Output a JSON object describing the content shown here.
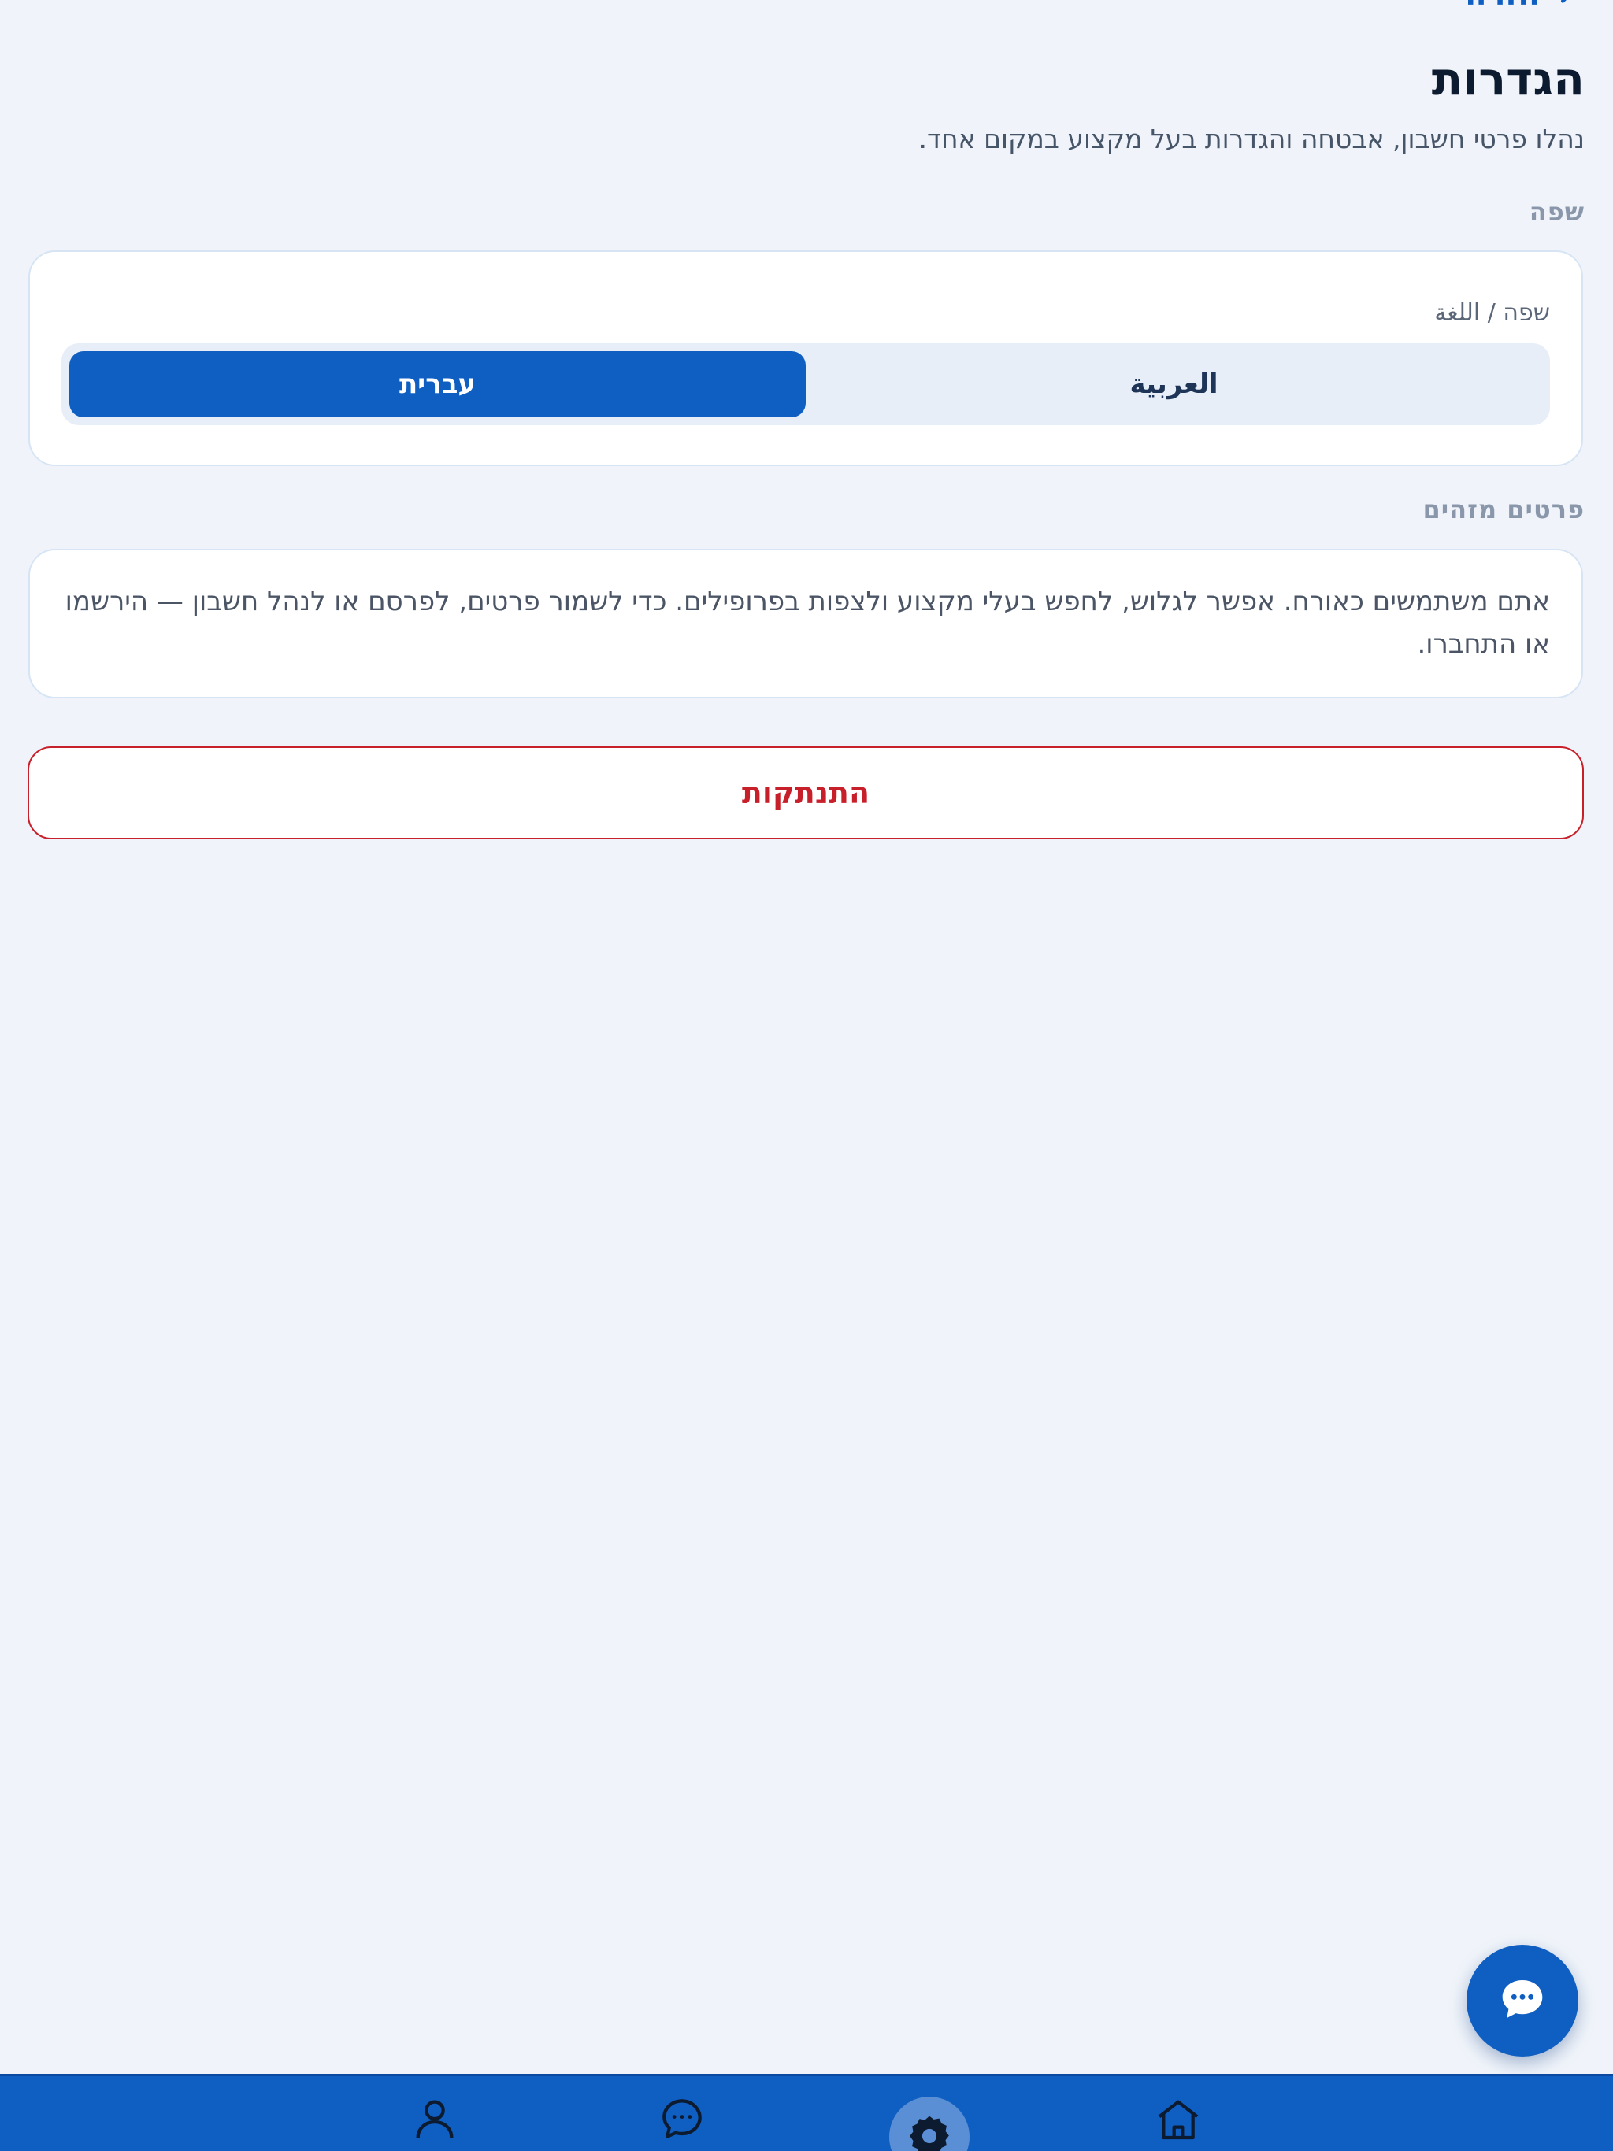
{
  "header": {
    "back_label": "חזרה",
    "title": "הגדרות",
    "subtitle": "נהלו פרטי חשבון, אבטחה והגדרות בעל מקצוע במקום אחד."
  },
  "language_section": {
    "heading": "שפה",
    "field_label": "שפה / اللغة",
    "options": [
      {
        "label": "עברית",
        "selected": true
      },
      {
        "label": "العربية",
        "selected": false
      }
    ]
  },
  "identity_section": {
    "heading": "פרטים מזהים",
    "text": "אתם משתמשים כאורח. אפשר לגלוש, לחפש בעלי מקצוע ולצפות בפרופילים. כדי לשמור פרטים, לפרסם או לנהל חשבון — הירשמו או התחברו."
  },
  "logout_label": "התנתקות",
  "chat_fab": {
    "icon": "chat-bubble-icon"
  },
  "bottom_nav": {
    "items": [
      {
        "icon": "home-icon",
        "active": false
      },
      {
        "icon": "gear-icon",
        "active": true
      },
      {
        "icon": "chat-icon",
        "active": false
      },
      {
        "icon": "user-icon",
        "active": false
      }
    ]
  },
  "colors": {
    "primary": "#0f5fc2",
    "danger": "#c8202a",
    "background": "#f0f4fa"
  }
}
